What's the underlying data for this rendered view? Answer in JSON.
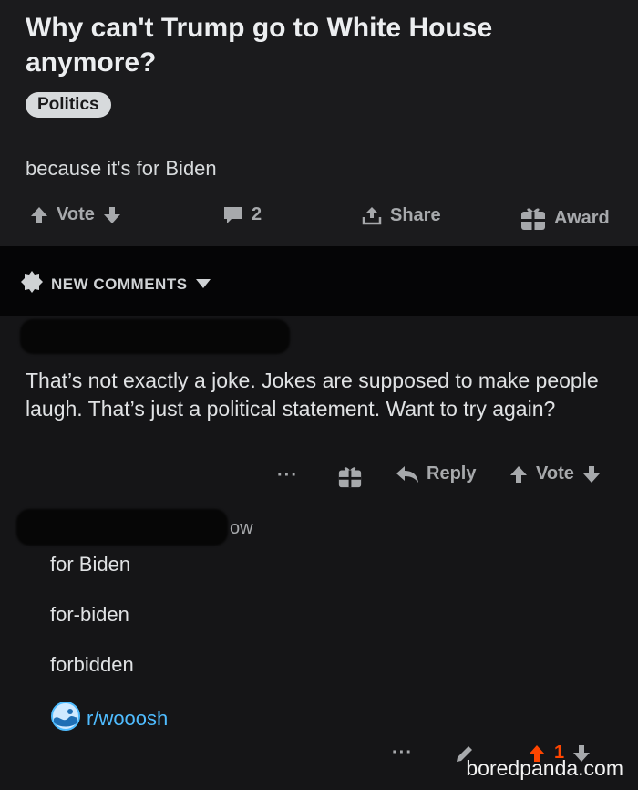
{
  "post": {
    "title": "Why can't Trump go to White House anymore?",
    "flair": "Politics",
    "body": "because it's for Biden",
    "actions": {
      "vote_label": "Vote",
      "comment_count": "2",
      "share_label": "Share",
      "award_label": "Award"
    }
  },
  "comments_header": {
    "label": "NEW COMMENTS"
  },
  "comment": {
    "text": "That’s not exactly a joke. Jokes are supposed to make people laugh. That’s just a political statement. Want to try again?",
    "actions": {
      "more_label": "···",
      "reply_label": "Reply",
      "vote_label": "Vote"
    }
  },
  "reply": {
    "partial_meta": "ow",
    "lines": [
      "for Biden",
      "for-biden",
      "forbidden"
    ],
    "subreddit_link": "r/wooosh",
    "vote_count": "1"
  },
  "watermark": "boredpanda.com",
  "colors": {
    "background": "#151517",
    "link": "#4fbcff",
    "upvote": "#ff4500"
  }
}
